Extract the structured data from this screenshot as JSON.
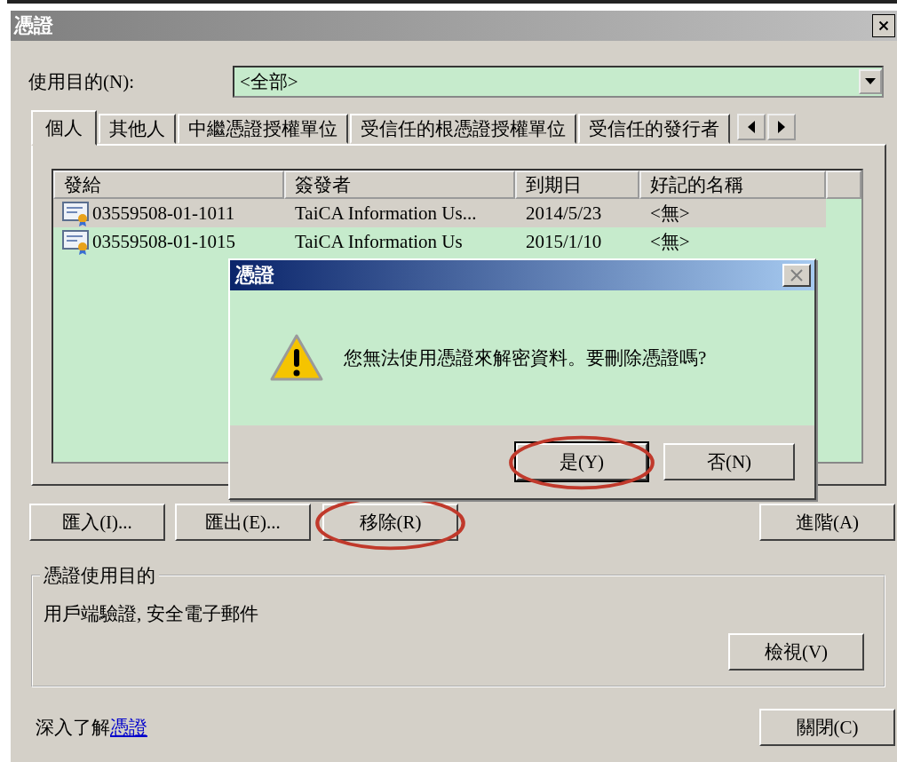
{
  "window": {
    "title": "憑證"
  },
  "purpose": {
    "label": "使用目的(N):",
    "value": "<全部>"
  },
  "tabs": [
    {
      "label": "個人",
      "selected": true
    },
    {
      "label": "其他人",
      "selected": false
    },
    {
      "label": "中繼憑證授權單位",
      "selected": false
    },
    {
      "label": "受信任的根憑證授權單位",
      "selected": false
    },
    {
      "label": "受信任的發行者",
      "selected": false
    }
  ],
  "table": {
    "columns": [
      "發給",
      "簽發者",
      "到期日",
      "好記的名稱"
    ],
    "rows": [
      {
        "cells": [
          "03559508-01-1011",
          "TaiCA Information Us...",
          "2014/5/23",
          "<無>"
        ],
        "selected": true
      },
      {
        "cells": [
          "03559508-01-1015",
          "TaiCA Information Us",
          "2015/1/10",
          "<無>"
        ],
        "selected": false
      }
    ]
  },
  "actions": [
    {
      "label": "匯入(I)...",
      "circled": false
    },
    {
      "label": "匯出(E)...",
      "circled": false
    },
    {
      "label": "移除(R)",
      "circled": true
    }
  ],
  "advanced_button": "進階(A)",
  "usage_group": {
    "title": "憑證使用目的",
    "text": "用戶端驗證, 安全電子郵件",
    "button": "檢視(V)"
  },
  "footer": {
    "text": "深入了解",
    "link": "憑證",
    "close_button": "關閉(C)"
  },
  "dialog": {
    "title": "憑證",
    "message": "您無法使用憑證來解密資料。要刪除憑證嗎?",
    "buttons": [
      {
        "label": "是(Y)",
        "default": true,
        "circled": true
      },
      {
        "label": "否(N)",
        "default": false,
        "circled": false
      }
    ]
  }
}
